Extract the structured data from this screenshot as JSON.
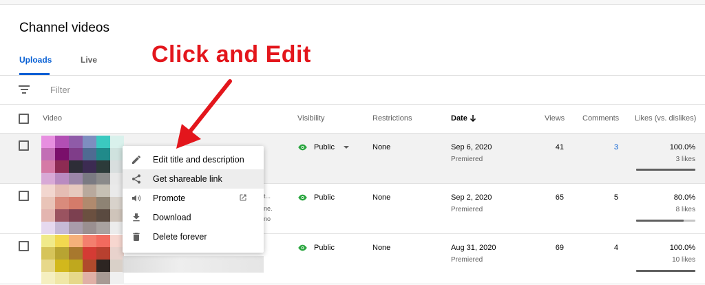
{
  "page": {
    "title": "Channel videos"
  },
  "tabs": [
    {
      "label": "Uploads",
      "active": true
    },
    {
      "label": "Live",
      "active": false
    }
  ],
  "annotation": {
    "text": "Click and Edit",
    "color": "#e3161c"
  },
  "filter": {
    "placeholder": "Filter"
  },
  "columns": {
    "video": "Video",
    "visibility": "Visibility",
    "restrictions": "Restrictions",
    "date": "Date",
    "views": "Views",
    "comments": "Comments",
    "likes": "Likes (vs. dislikes)"
  },
  "rows": [
    {
      "visibility": "Public",
      "restrictions": "None",
      "date": "Sep 6, 2020",
      "date_sub": "Premiered",
      "views": "41",
      "comments": "3",
      "likes_pct": "100.0%",
      "likes_count": "3 likes",
      "likes_ratio": 1.0,
      "hover": true
    },
    {
      "visibility": "Public",
      "restrictions": "None",
      "date": "Sep 2, 2020",
      "date_sub": "Premiered",
      "views": "65",
      "comments": "5",
      "likes_pct": "80.0%",
      "likes_count": "8 likes",
      "likes_ratio": 0.8,
      "hover": false
    },
    {
      "visibility": "Public",
      "restrictions": "None",
      "date": "Aug 31, 2020",
      "date_sub": "Premiered",
      "views": "69",
      "comments": "4",
      "likes_pct": "100.0%",
      "likes_count": "10 likes",
      "likes_ratio": 1.0,
      "hover": false
    }
  ],
  "truncated_text": {
    "line1": "t...",
    "line2": "ne.",
    "line3": "no"
  },
  "menu": {
    "items": [
      {
        "label": "Edit title and description",
        "icon": "pencil-icon"
      },
      {
        "label": "Get shareable link",
        "icon": "share-icon"
      },
      {
        "label": "Promote",
        "icon": "megaphone-icon"
      },
      {
        "label": "Download",
        "icon": "download-icon"
      },
      {
        "label": "Delete forever",
        "icon": "trash-icon"
      }
    ]
  },
  "colors": {
    "accent": "#065fd4",
    "public_eye": "#2ba640",
    "comment_link": "#065fd4"
  }
}
